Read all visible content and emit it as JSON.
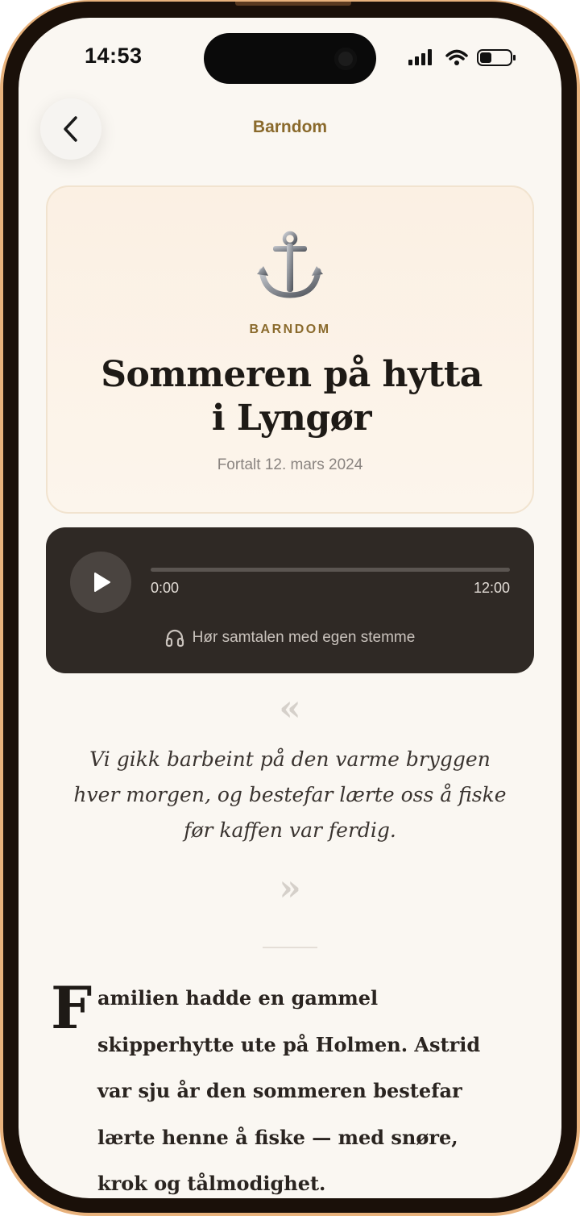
{
  "status_bar": {
    "time": "14:53"
  },
  "header": {
    "title": "Barndom"
  },
  "hero": {
    "icon": "anchor-icon",
    "category": "BARNDOM",
    "title_line1": "Sommeren på hytta",
    "title_line2": "i Lyngør",
    "date": "Fortalt 12. mars 2024"
  },
  "audio": {
    "current_time": "0:00",
    "total_time": "12:00",
    "progress": 0,
    "listen_label": "Hør samtalen med egen stemme"
  },
  "quote": {
    "open_mark": "«",
    "line1": "Vi gikk barbeint på den varme bryggen",
    "line2": "hver morgen, og bestefar lærte oss å fiske",
    "line3": "før kaffen var ferdig.",
    "close_mark": "»"
  },
  "story": {
    "drop_cap": "F",
    "lines": [
      "amilien hadde en gammel",
      "skipperhytte ute på Holmen. Astrid",
      "var sju år den sommeren bestefar",
      "lærte henne å fiske — med snøre,",
      "krok og tålmodighet."
    ]
  },
  "colors": {
    "accent": "#8a6a2c",
    "background": "#faf7f2",
    "player": "#2f2925"
  }
}
